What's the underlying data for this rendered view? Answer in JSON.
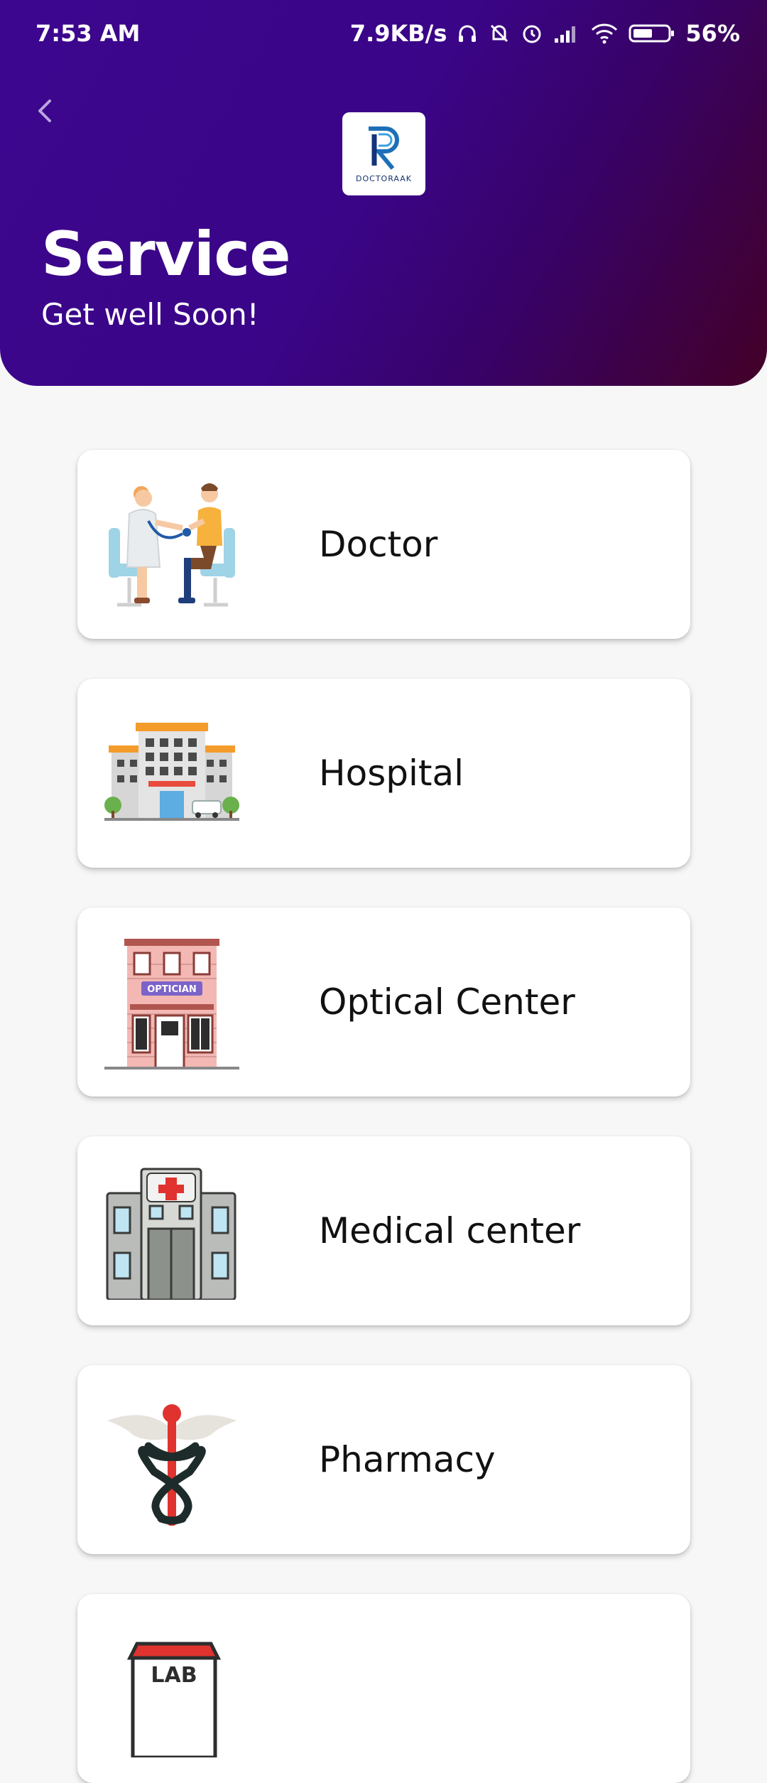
{
  "status_bar": {
    "time": "7:53 AM",
    "speed": "7.9KB/s",
    "battery": "56%"
  },
  "header": {
    "title": "Service",
    "subtitle": "Get well Soon!",
    "logo_text": "DOCTORAAK"
  },
  "services": [
    {
      "label": "Doctor",
      "icon": "doctor-patient-icon"
    },
    {
      "label": "Hospital",
      "icon": "hospital-building-icon"
    },
    {
      "label": "Optical Center",
      "icon": "optician-building-icon"
    },
    {
      "label": "Medical center",
      "icon": "medical-center-icon"
    },
    {
      "label": "Pharmacy",
      "icon": "caduceus-icon"
    },
    {
      "label": "",
      "icon": "lab-icon"
    }
  ],
  "lab_sign_text": "LAB",
  "optician_sign_text": "OPTICIAN",
  "colors": {
    "header_start": "#3d068f",
    "header_end": "#430027",
    "background": "#f7f7f7"
  }
}
